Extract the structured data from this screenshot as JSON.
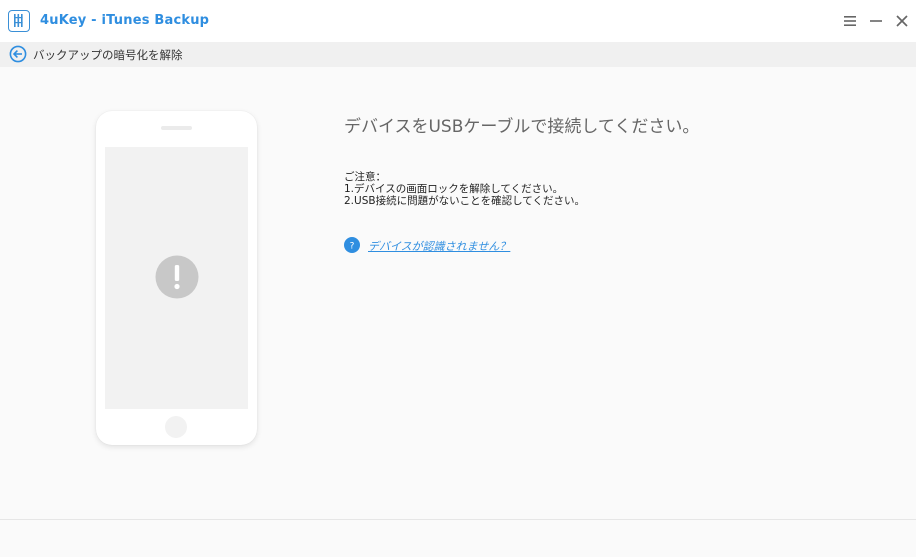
{
  "titlebar": {
    "app_title": "4uKey - iTunes Backup",
    "logo_icon": "app-logo-icon",
    "accent_color": "#2f8ee0",
    "controls": {
      "menu_icon": "hamburger-menu-icon",
      "minimize_icon": "minimize-icon",
      "close_icon": "close-icon"
    }
  },
  "navbar": {
    "back_icon": "back-arrow-circle-icon",
    "label": "バックアップの暗号化を解除"
  },
  "phone": {
    "status_icon": "exclamation-warning-icon"
  },
  "main": {
    "heading": "デバイスをUSBケーブルで接続してください。",
    "notes_title": "ご注意：",
    "notes": [
      "1.デバイスの画面ロックを解除してください。",
      "2.USB接続に問題がないことを確認してください。"
    ],
    "help_icon": "question-circle-icon",
    "help_link": "デバイスが認識されません？"
  }
}
